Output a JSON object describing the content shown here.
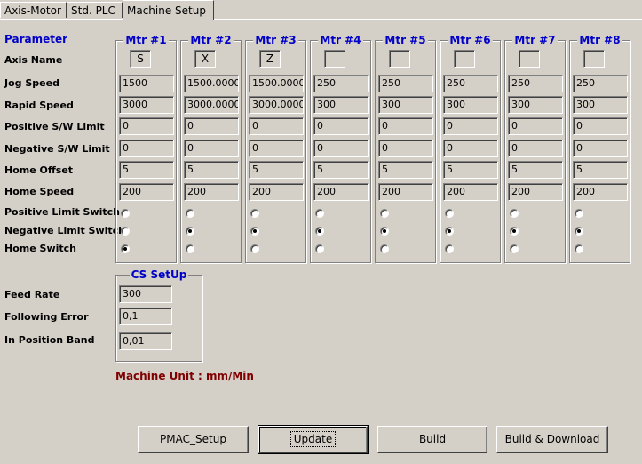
{
  "tabs": [
    "Axis-Motor",
    "Std. PLC",
    "Machine Setup"
  ],
  "active_tab": "Machine Setup",
  "parameter_title": "Parameter",
  "row_labels": {
    "axis_name": "Axis Name",
    "jog_speed": "Jog Speed",
    "rapid_speed": "Rapid Speed",
    "pos_sw_limit": "Positive S/W Limit",
    "neg_sw_limit": "Negative S/W Limit",
    "home_offset": "Home  Offset",
    "home_speed": "Home  Speed",
    "pos_limit_switch": "Positive Limit Switch",
    "neg_limit_switch": "Negative Limit Switch",
    "home_switch": "Home  Switch"
  },
  "motors": [
    {
      "title": "Mtr #1",
      "axis_name": "S",
      "jog_speed": "1500",
      "rapid_speed": "3000",
      "pos_sw_limit": "0",
      "neg_sw_limit": "0",
      "home_offset": "5",
      "home_speed": "200",
      "limit_switch": "home"
    },
    {
      "title": "Mtr #2",
      "axis_name": "X",
      "jog_speed": "1500.0000",
      "rapid_speed": "3000.0000",
      "pos_sw_limit": "0",
      "neg_sw_limit": "0",
      "home_offset": "5",
      "home_speed": "200",
      "limit_switch": "negative"
    },
    {
      "title": "Mtr #3",
      "axis_name": "Z",
      "jog_speed": "1500.0000",
      "rapid_speed": "3000.0000",
      "pos_sw_limit": "0",
      "neg_sw_limit": "0",
      "home_offset": "5",
      "home_speed": "200",
      "limit_switch": "negative"
    },
    {
      "title": "Mtr #4",
      "axis_name": "",
      "jog_speed": "250",
      "rapid_speed": "300",
      "pos_sw_limit": "0",
      "neg_sw_limit": "0",
      "home_offset": "5",
      "home_speed": "200",
      "limit_switch": "negative"
    },
    {
      "title": "Mtr #5",
      "axis_name": "",
      "jog_speed": "250",
      "rapid_speed": "300",
      "pos_sw_limit": "0",
      "neg_sw_limit": "0",
      "home_offset": "5",
      "home_speed": "200",
      "limit_switch": "negative"
    },
    {
      "title": "Mtr #6",
      "axis_name": "",
      "jog_speed": "250",
      "rapid_speed": "300",
      "pos_sw_limit": "0",
      "neg_sw_limit": "0",
      "home_offset": "5",
      "home_speed": "200",
      "limit_switch": "negative"
    },
    {
      "title": "Mtr #7",
      "axis_name": "",
      "jog_speed": "250",
      "rapid_speed": "300",
      "pos_sw_limit": "0",
      "neg_sw_limit": "0",
      "home_offset": "5",
      "home_speed": "200",
      "limit_switch": "negative"
    },
    {
      "title": "Mtr #8",
      "axis_name": "",
      "jog_speed": "250",
      "rapid_speed": "300",
      "pos_sw_limit": "0",
      "neg_sw_limit": "0",
      "home_offset": "5",
      "home_speed": "200",
      "limit_switch": "negative"
    }
  ],
  "cs_setup": {
    "title": "CS SetUp",
    "feed_rate_label": "Feed Rate",
    "feed_rate": "300",
    "following_error_label": "Following Error",
    "following_error": "0,1",
    "in_position_band_label": "In Position Band",
    "in_position_band": "0,01"
  },
  "machine_unit": "Machine Unit :  mm/Min",
  "buttons": {
    "pmac_setup": "PMAC_Setup",
    "update": "Update",
    "build": "Build",
    "build_download": "Build & Download"
  },
  "colors": {
    "background": "#d4d0c8",
    "title_blue": "#0000c8",
    "unit_red": "#800000"
  }
}
